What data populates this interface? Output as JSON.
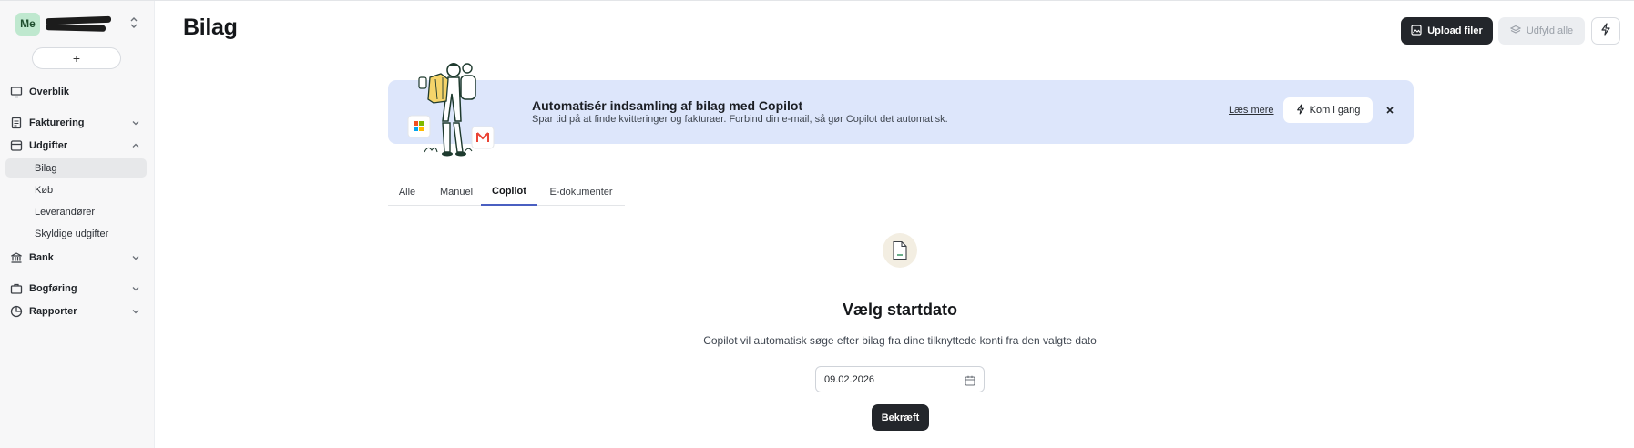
{
  "sidebar": {
    "org_initials": "Me",
    "add_label": "+",
    "nav": {
      "overblik": "Overblik",
      "fakturering": "Fakturering",
      "udgifter": "Udgifter",
      "bank": "Bank",
      "bogforing": "Bogføring",
      "rapporter": "Rapporter"
    },
    "udgifter_sub": {
      "bilag": "Bilag",
      "kob": "Køb",
      "leverandorer": "Leverandører",
      "skyldige": "Skyldige udgifter"
    },
    "active_item": "Bilag"
  },
  "header": {
    "title": "Bilag",
    "upload_label": "Upload filer",
    "fill_label": "Udfyld alle"
  },
  "banner": {
    "title": "Automatisér indsamling af bilag med Copilot",
    "subtitle": "Spar tid på at finde kvitteringer og fakturaer. Forbind din e-mail, så gør Copilot det automatisk.",
    "link_label": "Læs mere",
    "cta_label": "Kom i gang"
  },
  "tabs": {
    "alle": "Alle",
    "manuel": "Manuel",
    "copilot": "Copilot",
    "edokumenter": "E-dokumenter",
    "active": "Copilot"
  },
  "empty_state": {
    "title": "Vælg startdato",
    "subtitle": "Copilot vil automatisk søge efter bilag fra dine tilknyttede konti fra den valgte dato",
    "date_value": "09.02.2026",
    "confirm_label": "Bekræft"
  },
  "colors": {
    "primary_button": "#23262b",
    "banner_bg": "#dde6fb",
    "active_tab_underline": "#4a5fc1",
    "avatar_bg": "#bfe8cf"
  }
}
